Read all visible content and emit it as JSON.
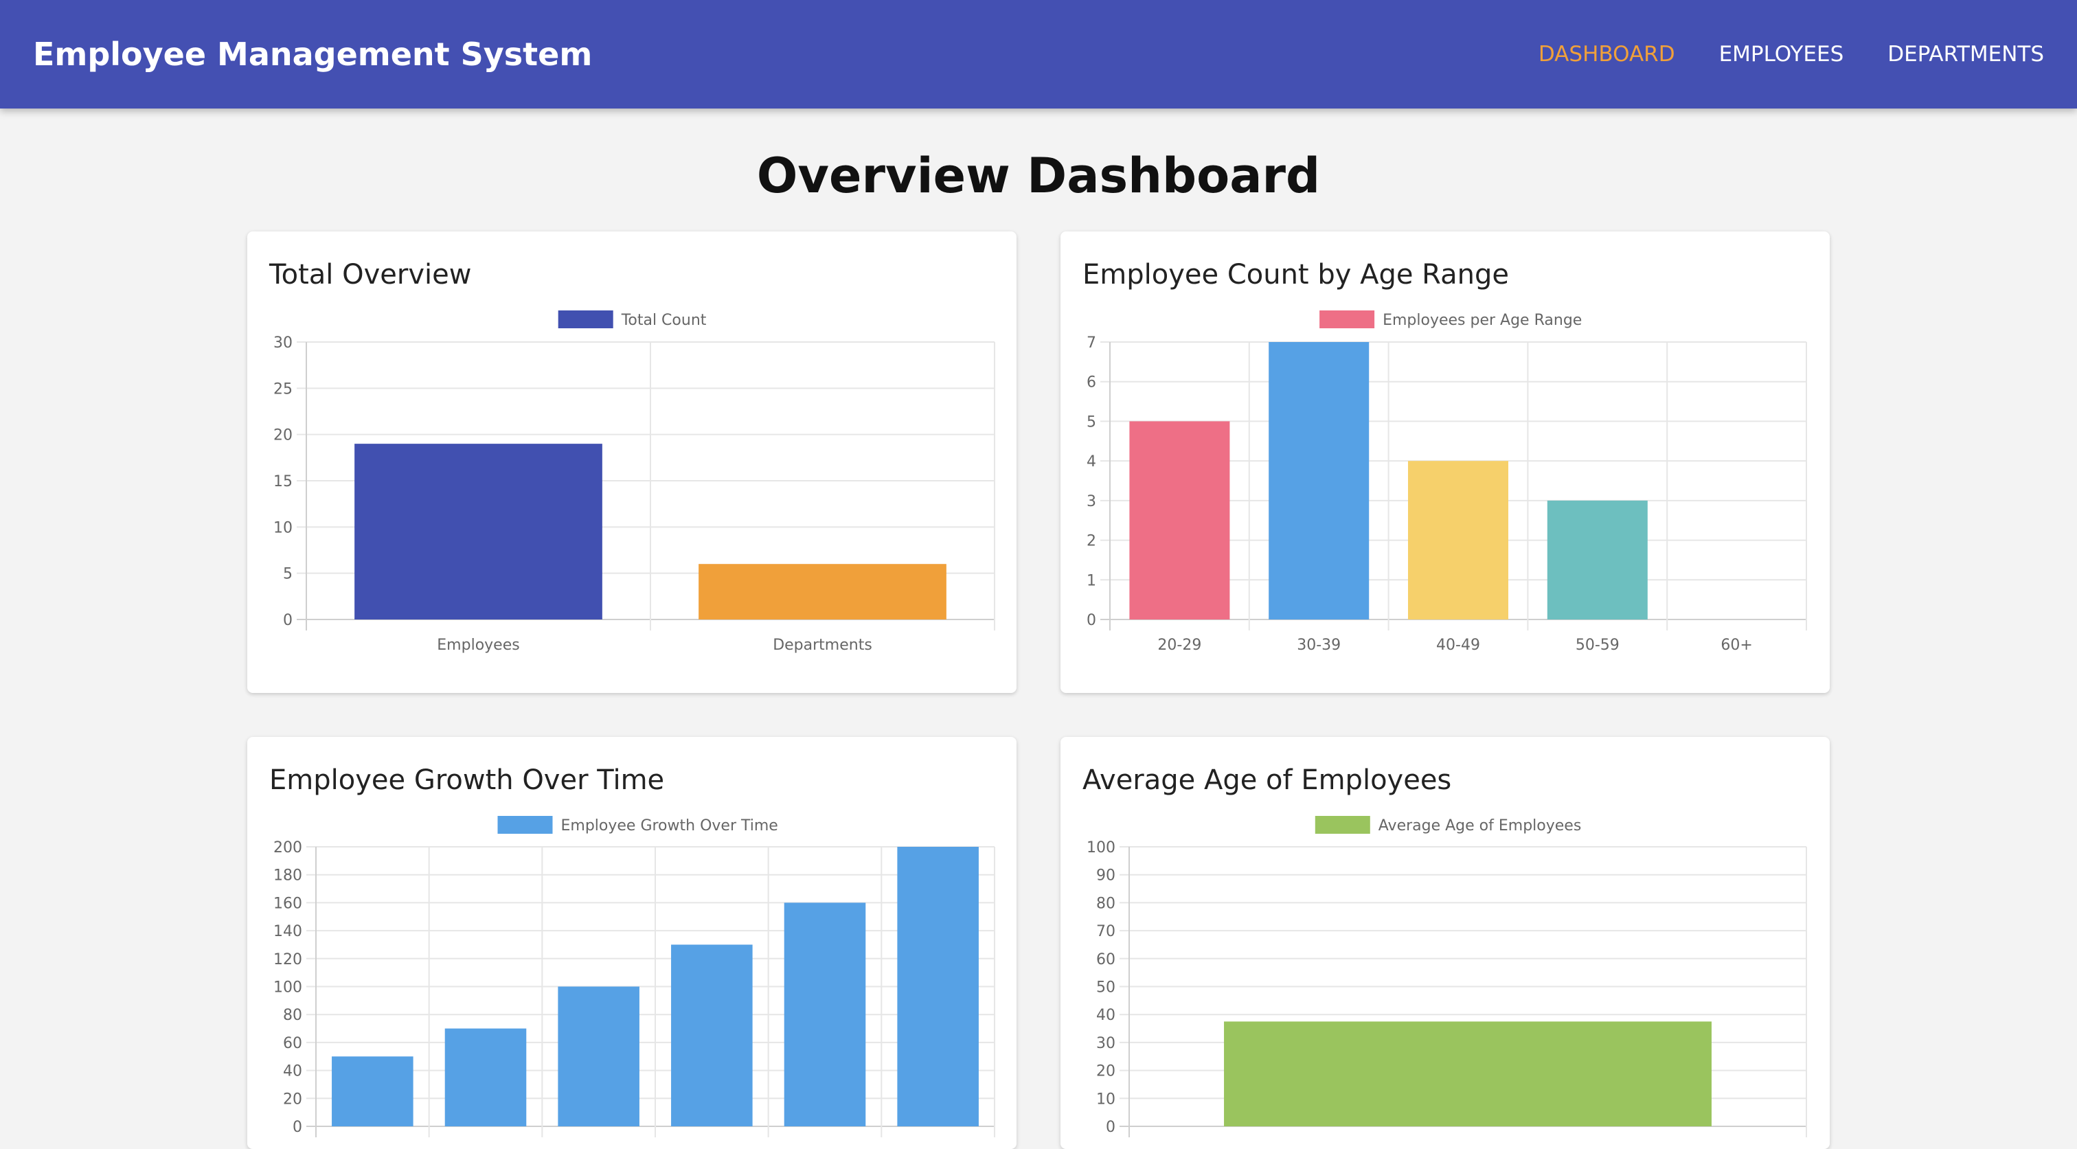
{
  "header": {
    "title": "Employee Management System",
    "nav": [
      {
        "label": "DASHBOARD",
        "active": true
      },
      {
        "label": "EMPLOYEES",
        "active": false
      },
      {
        "label": "DEPARTMENTS",
        "active": false
      }
    ],
    "bg_color": "#4450b2",
    "active_color": "#f0a03a"
  },
  "page": {
    "title": "Overview Dashboard"
  },
  "charts": [
    {
      "title": "Total Overview",
      "chart_data": {
        "type": "bar",
        "categories": [
          "Employees",
          "Departments"
        ],
        "series": [
          {
            "name": "Total Count",
            "values": [
              19,
              6
            ]
          }
        ],
        "colors": [
          "#4150b0",
          "#f0a03a"
        ],
        "legend_color": "#4150b0",
        "ylim": [
          0,
          30
        ],
        "yticks": [
          0,
          5,
          10,
          15,
          20,
          25,
          30
        ],
        "grid": true,
        "legend": "top"
      }
    },
    {
      "title": "Employee Count by Age Range",
      "chart_data": {
        "type": "bar",
        "categories": [
          "20-29",
          "30-39",
          "40-49",
          "50-59",
          "60+"
        ],
        "series": [
          {
            "name": "Employees per Age Range",
            "values": [
              5,
              7,
              4,
              3,
              0
            ]
          }
        ],
        "colors": [
          "#ee6f86",
          "#56a1e5",
          "#f6d06b",
          "#6dbfbf",
          "#9a7ddb"
        ],
        "legend_color": "#ee6f86",
        "ylim": [
          0,
          7
        ],
        "yticks": [
          0,
          1,
          2,
          3,
          4,
          5,
          6,
          7
        ],
        "grid": true,
        "legend": "top"
      }
    },
    {
      "title": "Employee Growth Over Time",
      "chart_data": {
        "type": "bar",
        "categories": [
          "",
          "",
          "",
          "",
          "",
          ""
        ],
        "series": [
          {
            "name": "Employee Growth Over Time",
            "values": [
              50,
              70,
              100,
              130,
              160,
              200
            ]
          }
        ],
        "colors": [
          "#56a1e5",
          "#56a1e5",
          "#56a1e5",
          "#56a1e5",
          "#56a1e5",
          "#56a1e5"
        ],
        "legend_color": "#56a1e5",
        "ylim": [
          0,
          200
        ],
        "yticks": [
          0,
          20,
          40,
          60,
          80,
          100,
          120,
          140,
          160,
          180,
          200
        ],
        "grid": true,
        "legend": "top"
      }
    },
    {
      "title": "Average Age of Employees",
      "chart_data": {
        "type": "bar",
        "categories": [
          ""
        ],
        "series": [
          {
            "name": "Average Age of Employees",
            "values": [
              37.5
            ]
          }
        ],
        "colors": [
          "#9ac45e"
        ],
        "legend_color": "#9ac45e",
        "ylim": [
          0,
          100
        ],
        "yticks": [
          0,
          10,
          20,
          30,
          40,
          50,
          60,
          70,
          80,
          90,
          100
        ],
        "grid": true,
        "legend": "top"
      }
    }
  ]
}
